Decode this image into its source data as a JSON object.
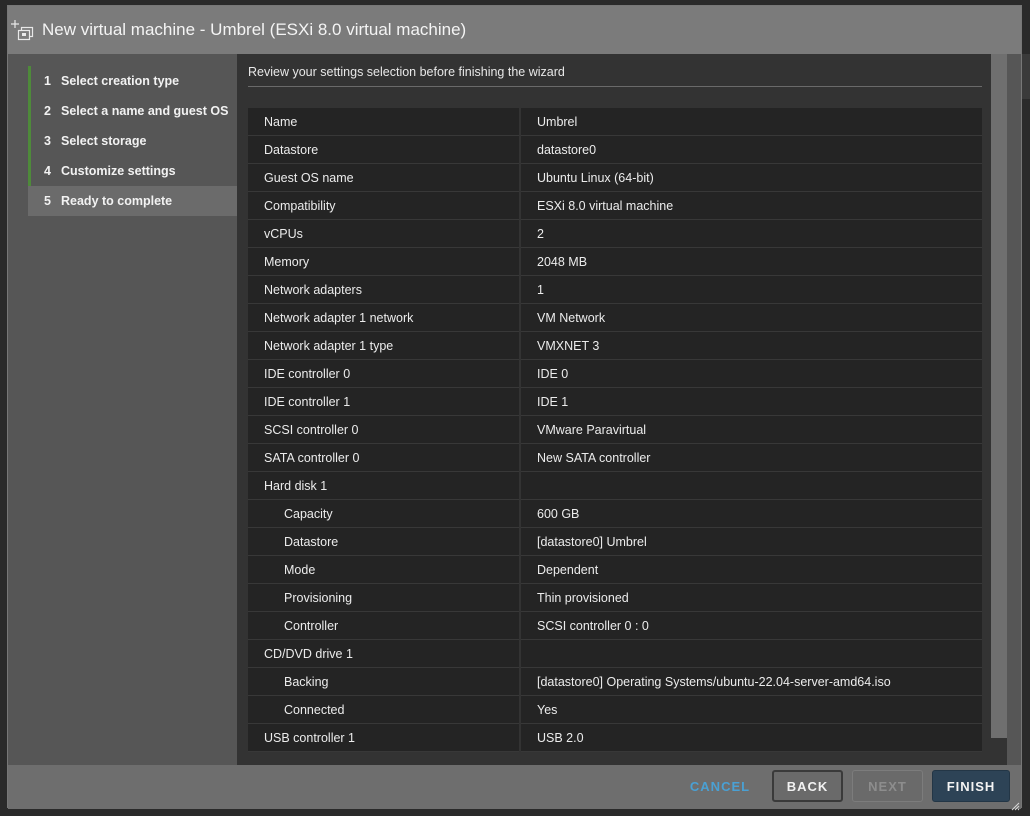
{
  "window": {
    "title": "New virtual machine - Umbrel (ESXi 8.0 virtual machine)",
    "icon": "add-vm-icon"
  },
  "steps": [
    {
      "num": "1",
      "label": "Select creation type",
      "active": false
    },
    {
      "num": "2",
      "label": "Select a name and guest OS",
      "active": false
    },
    {
      "num": "3",
      "label": "Select storage",
      "active": false
    },
    {
      "num": "4",
      "label": "Customize settings",
      "active": false
    },
    {
      "num": "5",
      "label": "Ready to complete",
      "active": true
    }
  ],
  "content": {
    "subtitle": "Review your settings selection before finishing the wizard"
  },
  "summary": [
    {
      "label": "Name",
      "value": "Umbrel",
      "child": false
    },
    {
      "label": "Datastore",
      "value": "datastore0",
      "child": false
    },
    {
      "label": "Guest OS name",
      "value": "Ubuntu Linux (64-bit)",
      "child": false
    },
    {
      "label": "Compatibility",
      "value": "ESXi 8.0 virtual machine",
      "child": false
    },
    {
      "label": "vCPUs",
      "value": "2",
      "child": false
    },
    {
      "label": "Memory",
      "value": "2048 MB",
      "child": false
    },
    {
      "label": "Network adapters",
      "value": "1",
      "child": false
    },
    {
      "label": "Network adapter 1 network",
      "value": "VM Network",
      "child": false
    },
    {
      "label": "Network adapter 1 type",
      "value": "VMXNET 3",
      "child": false
    },
    {
      "label": "IDE controller 0",
      "value": "IDE 0",
      "child": false
    },
    {
      "label": "IDE controller 1",
      "value": "IDE 1",
      "child": false
    },
    {
      "label": "SCSI controller 0",
      "value": "VMware Paravirtual",
      "child": false
    },
    {
      "label": "SATA controller 0",
      "value": "New SATA controller",
      "child": false
    },
    {
      "label": "Hard disk 1",
      "value": "",
      "child": false
    },
    {
      "label": "Capacity",
      "value": "600 GB",
      "child": true
    },
    {
      "label": "Datastore",
      "value": "[datastore0] Umbrel",
      "child": true
    },
    {
      "label": "Mode",
      "value": "Dependent",
      "child": true
    },
    {
      "label": "Provisioning",
      "value": "Thin provisioned",
      "child": true
    },
    {
      "label": "Controller",
      "value": "SCSI controller 0 : 0",
      "child": true
    },
    {
      "label": "CD/DVD drive 1",
      "value": "",
      "child": false
    },
    {
      "label": "Backing",
      "value": "[datastore0] Operating Systems/ubuntu-22.04-server-amd64.iso",
      "child": true
    },
    {
      "label": "Connected",
      "value": "Yes",
      "child": true
    },
    {
      "label": "USB controller 1",
      "value": "USB 2.0",
      "child": false
    }
  ],
  "footer": {
    "cancel_label": "CANCEL",
    "back_label": "BACK",
    "next_label": "NEXT",
    "finish_label": "FINISH"
  },
  "colors": {
    "step_accent": "#4e8a3a",
    "cancel_link": "#4aa0d3",
    "finish_button": "#2d4356"
  }
}
